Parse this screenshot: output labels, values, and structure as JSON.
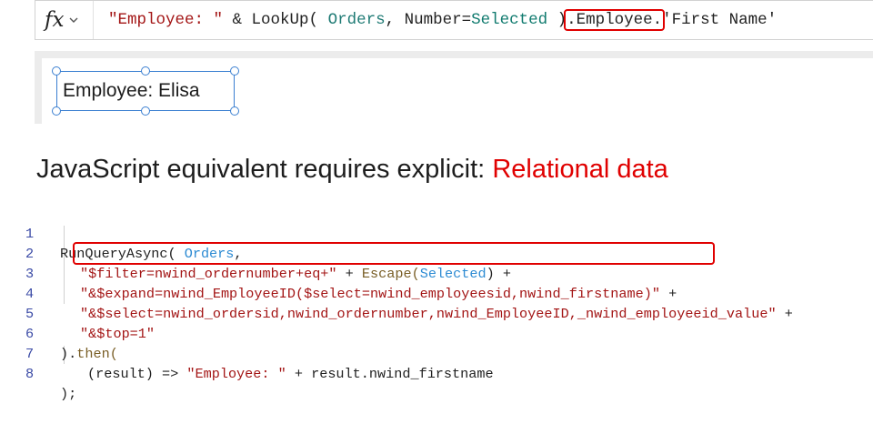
{
  "formula_bar": {
    "fx_label": "fx",
    "parts": {
      "p1": "\"Employee: \"",
      "p2": " & ",
      "p3": "LookUp(",
      "p4": " Orders",
      "p5": ", Number=",
      "p6": "Selected",
      "p7": " )",
      "p8": ".Employee.",
      "p9": "'First Name'"
    }
  },
  "canvas": {
    "label_text": "Employee: Elisa"
  },
  "heading": {
    "text": "JavaScript equivalent requires explicit: ",
    "accent": "Relational data"
  },
  "code": {
    "line_numbers": [
      "1",
      "2",
      "3",
      "4",
      "5",
      "6",
      "7",
      "8"
    ],
    "l1": {
      "a": "RunQueryAsync( ",
      "b": "Orders",
      "c": ","
    },
    "l2": {
      "a": "\"$filter=nwind_ordernumber+eq+\"",
      "b": " + ",
      "c": "Escape(",
      "d": "Selected",
      "e": ") +"
    },
    "l3": {
      "a": "\"&$expand=nwind_EmployeeID($select=nwind_employeesid,nwind_firstname)\"",
      "b": " +"
    },
    "l4": {
      "a": "\"&$select=nwind_ordersid,nwind_ordernumber,nwind_EmployeeID,_nwind_employeeid_value\"",
      "b": " +"
    },
    "l5": {
      "a": "\"&$top=1\""
    },
    "l6": {
      "a": ").",
      "b": "then("
    },
    "l7": {
      "a": "(result) => ",
      "b": "\"Employee: \"",
      "c": " + result.nwind_firstname"
    },
    "l8": {
      "a": ");"
    }
  },
  "colors": {
    "highlight": "#e00000",
    "selection": "#3a7fd1",
    "string": "#a31515",
    "identifier": "#2d8bd3"
  }
}
